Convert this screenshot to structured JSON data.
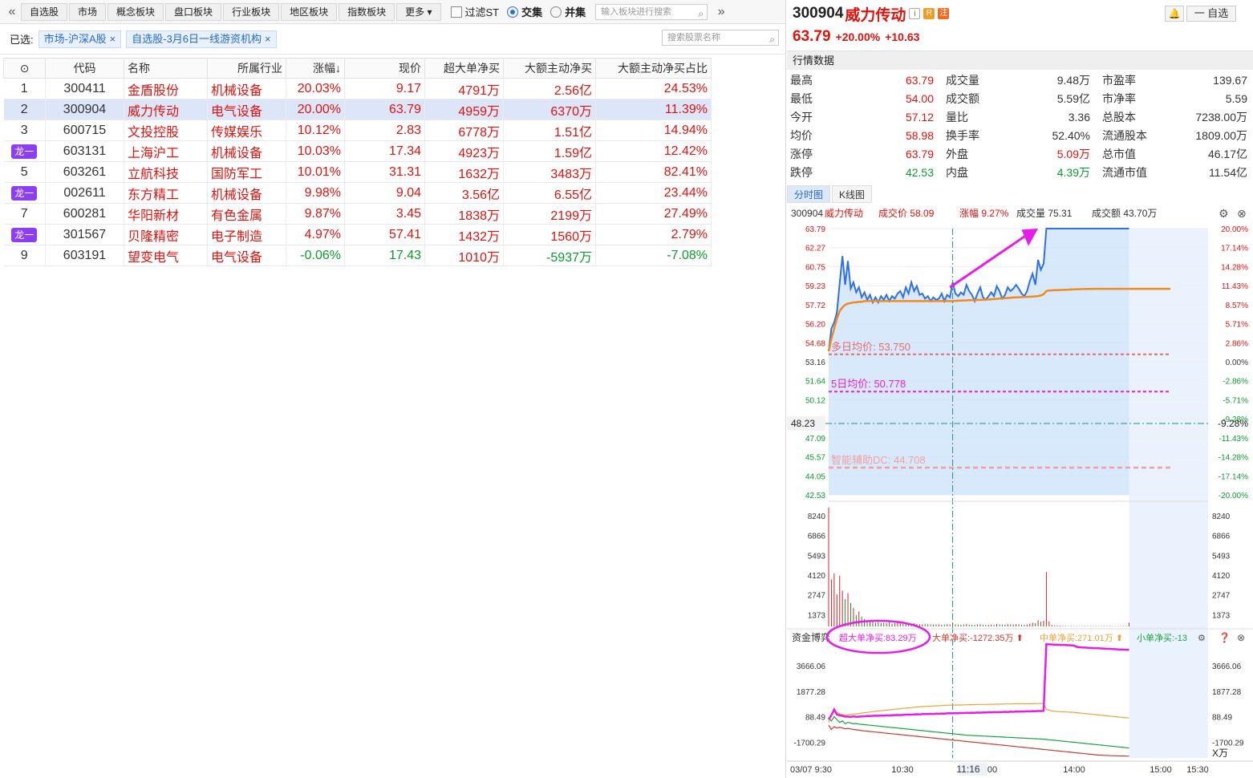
{
  "toolbar": {
    "tabs": [
      "自选股",
      "市场",
      "概念板块",
      "盘口板块",
      "行业板块",
      "地区板块",
      "指数板块",
      "更多"
    ],
    "filter_st": "过滤ST",
    "intersect": "交集",
    "union": "并集",
    "board_search_placeholder": "输入板块进行搜索"
  },
  "selected": {
    "label": "已选:",
    "chips": [
      "市场-沪深A股",
      "自选股-3月6日一线游资机构"
    ]
  },
  "stock_search_placeholder": "搜索股票名称",
  "table": {
    "headers": [
      "代码",
      "名称",
      "所属行业",
      "涨幅↓",
      "现价",
      "超大单净买",
      "大额主动净买",
      "大额主动净买占比"
    ],
    "rows": [
      {
        "idx": "1",
        "code": "300411",
        "name": "金盾股份",
        "industry": "机械设备",
        "chg": "20.03%",
        "price": "9.17",
        "super": "4791万",
        "big": "2.56亿",
        "pct": "24.53%"
      },
      {
        "idx": "2",
        "code": "300904",
        "name": "威力传动",
        "industry": "电气设备",
        "chg": "20.00%",
        "price": "63.79",
        "super": "4959万",
        "big": "6370万",
        "pct": "11.39%"
      },
      {
        "idx": "3",
        "code": "600715",
        "name": "文投控股",
        "industry": "传媒娱乐",
        "chg": "10.12%",
        "price": "2.83",
        "super": "6778万",
        "big": "1.51亿",
        "pct": "14.94%"
      },
      {
        "idx": "龙一",
        "code": "603131",
        "name": "上海沪工",
        "industry": "机械设备",
        "chg": "10.03%",
        "price": "17.34",
        "super": "4923万",
        "big": "1.59亿",
        "pct": "12.42%"
      },
      {
        "idx": "5",
        "code": "603261",
        "name": "立航科技",
        "industry": "国防军工",
        "chg": "10.01%",
        "price": "31.31",
        "super": "1632万",
        "big": "3483万",
        "pct": "82.41%"
      },
      {
        "idx": "龙一",
        "code": "002611",
        "name": "东方精工",
        "industry": "机械设备",
        "chg": "9.98%",
        "price": "9.04",
        "super": "3.56亿",
        "big": "6.55亿",
        "pct": "23.44%"
      },
      {
        "idx": "7",
        "code": "600281",
        "name": "华阳新材",
        "industry": "有色金属",
        "chg": "9.87%",
        "price": "3.45",
        "super": "1838万",
        "big": "2199万",
        "pct": "27.49%"
      },
      {
        "idx": "龙一",
        "code": "301567",
        "name": "贝隆精密",
        "industry": "电子制造",
        "chg": "4.97%",
        "price": "57.41",
        "super": "1432万",
        "big": "1560万",
        "pct": "2.79%"
      },
      {
        "idx": "9",
        "code": "603191",
        "name": "望变电气",
        "industry": "电气设备",
        "chg": "-0.06%",
        "price": "17.43",
        "super": "1010万",
        "big": "-5937万",
        "pct": "-7.08%"
      }
    ]
  },
  "stock": {
    "code": "300904",
    "name": "威力传动",
    "price": "63.79",
    "chg_pct": "+20.00%",
    "chg_amt": "+10.63",
    "add_label": "一 自选"
  },
  "quote": {
    "title": "行情数据",
    "rows": [
      [
        [
          "最高",
          "63.79",
          "red"
        ],
        [
          "成交量",
          "9.48万",
          ""
        ],
        [
          "市盈率",
          "139.67",
          ""
        ]
      ],
      [
        [
          "最低",
          "54.00",
          "red"
        ],
        [
          "成交额",
          "5.59亿",
          ""
        ],
        [
          "市净率",
          "5.59",
          ""
        ]
      ],
      [
        [
          "今开",
          "57.12",
          "red"
        ],
        [
          "量比",
          "3.36",
          ""
        ],
        [
          "总股本",
          "7238.00万",
          ""
        ]
      ],
      [
        [
          "均价",
          "58.98",
          "red"
        ],
        [
          "换手率",
          "52.40%",
          ""
        ],
        [
          "流通股本",
          "1809.00万",
          ""
        ]
      ],
      [
        [
          "涨停",
          "63.79",
          "red"
        ],
        [
          "外盘",
          "5.09万",
          "red"
        ],
        [
          "总市值",
          "46.17亿",
          ""
        ]
      ],
      [
        [
          "跌停",
          "42.53",
          "green"
        ],
        [
          "内盘",
          "4.39万",
          "green"
        ],
        [
          "流通市值",
          "11.54亿",
          ""
        ]
      ]
    ]
  },
  "chart_tabs": [
    "分时图",
    "K线图"
  ],
  "chart_data": {
    "type": "line",
    "header": {
      "code_name": "300904威力传动",
      "price": "成交价 58.09",
      "chg": "涨幅 9.27%",
      "vol": "成交量 75.31",
      "amt": "成交额 43.70万"
    },
    "price_ticks": [
      "63.79",
      "62.27",
      "60.75",
      "59.23",
      "57.72",
      "56.20",
      "54.68",
      "53.16",
      "51.64",
      "50.12",
      "48.23",
      "47.09",
      "45.57",
      "44.05",
      "42.53"
    ],
    "pct_ticks": [
      "20.00%",
      "17.14%",
      "14.28%",
      "11.43%",
      "8.57%",
      "5.71%",
      "2.86%",
      "0.00%",
      "-2.86%",
      "-5.71%",
      "-9.28%",
      "-11.43%",
      "-14.28%",
      "-17.14%",
      "-20.00%"
    ],
    "ylim": [
      42.53,
      63.79
    ],
    "prev_close": 53.16,
    "cursor_price": 48.23,
    "multi_day_avg_label": "多日均价: 53.750",
    "multi_day_avg": 53.75,
    "five_day_avg_label": "5日均价: 50.778",
    "five_day_avg": 50.778,
    "dc_label": "智能辅助DC: 44.708",
    "dc_value": 44.708,
    "price_series": [
      54.0,
      55.8,
      56.3,
      57.1,
      59.4,
      61.6,
      59.3,
      61.2,
      59.0,
      59.5,
      58.7,
      59.1,
      58.3,
      58.7,
      58.1,
      58.5,
      57.9,
      58.3,
      57.9,
      58.4,
      58.1,
      58.5,
      58.0,
      58.4,
      58.2,
      58.6,
      58.8,
      58.3,
      59.1,
      58.6,
      59.5,
      58.8,
      59.2,
      58.5,
      58.6,
      58.2,
      58.4,
      58.0,
      58.3,
      58.1,
      58.2,
      58.6,
      58.0,
      58.5,
      58.3,
      59.5,
      58.6,
      58.4,
      58.7,
      58.5,
      59.3,
      58.8,
      58.5,
      58.0,
      58.6,
      59.1,
      58.3,
      58.1,
      58.4,
      58.7,
      58.4,
      59.2,
      58.8,
      58.2,
      58.5,
      59.1,
      58.8,
      59.0,
      59.3,
      59.0,
      58.6,
      58.4,
      58.8,
      59.6,
      60.2,
      59.3,
      61.3,
      60.5,
      61.0,
      63.79,
      63.79,
      63.79,
      63.79,
      63.79,
      63.79,
      63.79,
      63.79,
      63.79,
      63.79,
      63.79,
      63.79,
      63.79,
      63.79,
      63.79,
      63.79,
      63.79,
      63.79,
      63.79,
      63.79,
      63.79,
      63.79,
      63.79,
      63.79,
      63.79,
      63.79,
      63.79,
      63.79,
      63.79,
      63.79,
      63.79
    ],
    "avg_series": [
      54.0,
      55.0,
      55.8,
      56.6,
      57.2,
      57.5,
      57.7,
      57.8,
      57.85,
      57.9,
      57.9,
      57.95,
      57.95,
      58.0,
      58.0,
      58.0,
      58.0,
      58.0,
      58.0,
      58.0,
      58.0,
      58.0,
      58.0,
      58.0,
      58.0,
      58.0,
      58.0,
      58.0,
      58.0,
      58.0,
      58.0,
      58.0,
      58.0,
      58.0,
      58.0,
      58.0,
      58.0,
      58.0,
      58.0,
      58.0,
      58.0,
      58.0,
      58.0,
      58.0,
      58.0,
      58.0,
      58.02,
      58.03,
      58.04,
      58.05,
      58.06,
      58.07,
      58.08,
      58.08,
      58.1,
      58.1,
      58.1,
      58.12,
      58.13,
      58.15,
      58.16,
      58.18,
      58.2,
      58.22,
      58.23,
      58.25,
      58.27,
      58.29,
      58.3,
      58.31,
      58.32,
      58.33,
      58.34,
      58.35,
      58.36,
      58.38,
      58.4,
      58.45,
      58.55,
      58.8,
      58.85,
      58.86,
      58.87,
      58.88,
      58.89,
      58.9,
      58.91,
      58.92,
      58.93,
      58.94,
      58.95,
      58.95,
      58.96,
      58.96,
      58.97,
      58.97,
      58.97,
      58.98,
      58.98,
      58.98,
      58.98,
      58.98,
      58.98,
      58.98,
      58.98,
      58.98,
      58.98,
      58.98,
      58.98,
      58.98
    ],
    "volume_ticks": [
      "8240",
      "6866",
      "5493",
      "4120",
      "2747",
      "1373"
    ],
    "volume_max": 9600,
    "volume_series": [
      9600,
      3800,
      4300,
      2600,
      4100,
      2900,
      2200,
      2700,
      1900,
      1500,
      900,
      1200,
      800,
      600,
      500,
      400,
      500,
      300,
      350,
      280,
      300,
      250,
      400,
      220,
      260,
      300,
      240,
      200,
      260,
      180,
      220,
      250,
      200,
      190,
      170,
      210,
      180,
      160,
      150,
      170,
      160,
      140,
      150,
      180,
      160,
      250,
      170,
      150,
      140,
      160,
      200,
      150,
      140,
      130,
      160,
      180,
      150,
      140,
      130,
      150,
      140,
      200,
      160,
      150,
      140,
      190,
      170,
      160,
      180,
      170,
      150,
      140,
      160,
      220,
      300,
      260,
      500,
      380,
      450,
      4400,
      400,
      120,
      80,
      60,
      50,
      40,
      40,
      30,
      30,
      30,
      30,
      30,
      30,
      30,
      30,
      30,
      30,
      30,
      30,
      30,
      30,
      30,
      30,
      30,
      30,
      30,
      30,
      30,
      30,
      300
    ],
    "flow_legend": {
      "title": "资金博弈",
      "super": "超大单净买:83.29万",
      "big": "大单净买:-1272.35万",
      "mid": "中单净买:271.01万",
      "small": "小单净买:-13"
    },
    "flow_ticks": [
      "3666.06",
      "1877.28",
      "88.49",
      "-1700.29"
    ],
    "flow_unit": "X万",
    "flow_ylim": [
      -2800,
      5200
    ],
    "flow_super": [
      -100,
      200,
      600,
      250,
      200,
      150,
      100,
      100,
      80,
      120,
      90,
      100,
      110,
      130,
      150,
      140,
      160,
      170,
      160,
      180,
      170,
      190,
      180,
      200,
      210,
      220,
      210,
      230,
      240,
      250,
      240,
      260,
      270,
      260,
      280,
      290,
      280,
      300,
      290,
      310,
      300,
      320,
      310,
      330,
      340,
      330,
      350,
      340,
      360,
      350,
      370,
      360,
      380,
      370,
      390,
      380,
      400,
      390,
      410,
      400,
      420,
      410,
      430,
      420,
      440,
      430,
      450,
      440,
      460,
      450,
      470,
      460,
      480,
      470,
      490,
      480,
      500,
      490,
      510,
      5200,
      5180,
      5170,
      5160,
      5150,
      5140,
      5140,
      5130,
      5120,
      5110,
      5100,
      5000,
      4980,
      4960,
      4950,
      4940,
      4930,
      4920,
      4910,
      4900,
      4890,
      4880,
      4870,
      4860,
      4850,
      4840,
      4830,
      4820,
      4810,
      4800,
      4790
    ],
    "flow_mid": [
      -300,
      200,
      500,
      400,
      300,
      250,
      200,
      220,
      250,
      280,
      300,
      320,
      350,
      380,
      400,
      420,
      450,
      480,
      500,
      520,
      540,
      560,
      580,
      600,
      620,
      640,
      660,
      680,
      700,
      720,
      740,
      760,
      780,
      800,
      810,
      820,
      830,
      840,
      850,
      860,
      870,
      880,
      890,
      900,
      900,
      910,
      910,
      920,
      920,
      930,
      930,
      940,
      940,
      950,
      950,
      960,
      960,
      960,
      970,
      970,
      970,
      980,
      980,
      980,
      990,
      990,
      990,
      1000,
      1000,
      1000,
      1000,
      1000,
      1000,
      1000,
      1010,
      1010,
      1020,
      1020,
      1030,
      600,
      550,
      500,
      480,
      460,
      450,
      440,
      430,
      420,
      410,
      400,
      380,
      360,
      340,
      320,
      300,
      280,
      260,
      240,
      220,
      200,
      180,
      160,
      140,
      120,
      100,
      80,
      60,
      40,
      20,
      10
    ],
    "flow_big": [
      -500,
      -800,
      -600,
      -700,
      -650,
      -700,
      -750,
      -720,
      -760,
      -800,
      -820,
      -850,
      -880,
      -900,
      -920,
      -940,
      -960,
      -980,
      -1000,
      -1020,
      -1040,
      -1060,
      -1080,
      -1100,
      -1120,
      -1140,
      -1160,
      -1180,
      -1200,
      -1220,
      -1240,
      -1260,
      -1280,
      -1300,
      -1320,
      -1340,
      -1360,
      -1380,
      -1400,
      -1420,
      -1440,
      -1460,
      -1480,
      -1500,
      -1520,
      -1540,
      -1560,
      -1580,
      -1600,
      -1620,
      -1640,
      -1660,
      -1680,
      -1700,
      -1720,
      -1740,
      -1760,
      -1780,
      -1800,
      -1820,
      -1840,
      -1860,
      -1880,
      -1900,
      -1920,
      -1940,
      -1960,
      -1980,
      -2000,
      -2020,
      -2040,
      -2060,
      -2080,
      -2100,
      -2120,
      -2140,
      -2160,
      -2180,
      -2200,
      -2220,
      -2240,
      -2260,
      -2280,
      -2300,
      -2320,
      -2340,
      -2360,
      -2380,
      -2400,
      -2420,
      -2440,
      -2460,
      -2480,
      -2500,
      -2520,
      -2540,
      -2560,
      -2580,
      -2600,
      -2600,
      -2620,
      -2620,
      -2640,
      -2640,
      -2650,
      -2650,
      -2660,
      -2660,
      -2670,
      -2670
    ],
    "flow_small": [
      0,
      -200,
      100,
      -100,
      -300,
      -200,
      -400,
      -300,
      -350,
      -400,
      -380,
      -420,
      -440,
      -460,
      -480,
      -500,
      -520,
      -540,
      -560,
      -580,
      -600,
      -620,
      -640,
      -660,
      -680,
      -700,
      -720,
      -740,
      -760,
      -780,
      -800,
      -820,
      -840,
      -860,
      -880,
      -900,
      -920,
      -940,
      -960,
      -980,
      -1000,
      -1020,
      -1040,
      -1060,
      -1080,
      -1100,
      -1120,
      -1140,
      -1160,
      -1180,
      -1200,
      -1210,
      -1220,
      -1230,
      -1240,
      -1250,
      -1260,
      -1270,
      -1280,
      -1290,
      -1300,
      -1310,
      -1320,
      -1330,
      -1340,
      -1350,
      -1360,
      -1370,
      -1380,
      -1390,
      -1400,
      -1410,
      -1420,
      -1430,
      -1440,
      -1450,
      -1460,
      -1470,
      -1480,
      -1500,
      -1520,
      -1540,
      -1560,
      -1580,
      -1600,
      -1620,
      -1640,
      -1660,
      -1680,
      -1700,
      -1720,
      -1740,
      -1760,
      -1780,
      -1800,
      -1820,
      -1840,
      -1860,
      -1880,
      -1900,
      -1920,
      -1940,
      -1960,
      -1980,
      -2000,
      -2020,
      -2040,
      -2060,
      -2080,
      -2100
    ],
    "x_ticks": [
      "03/07 9:30",
      "10:30",
      "11:16",
      "00",
      "14:00",
      "15:00",
      "15:30"
    ],
    "colors": {
      "price_line": "#2f6fe8",
      "avg_line": "#f08a1c",
      "area_fill": "#cfe3fb",
      "super": "#e51de8",
      "mid": "#e8a23a",
      "big": "#c8392e",
      "small": "#15a23b",
      "annotation": "#e51de8"
    }
  }
}
